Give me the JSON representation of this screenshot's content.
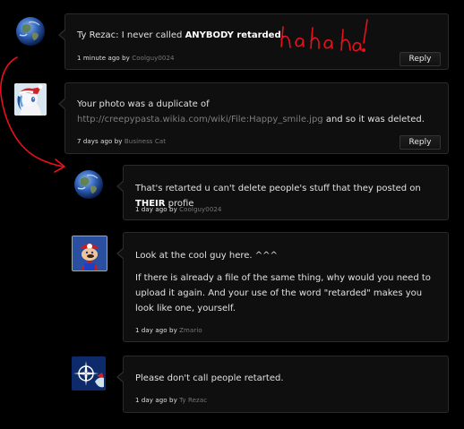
{
  "comments": [
    {
      "pre": "Ty Rezac: I never called ",
      "bold": "ANYBODY retarded.",
      "time": "1 minute ago by",
      "user": "Coolguy0024",
      "reply": "Reply",
      "avatar": "earth-avatar"
    },
    {
      "pre": "Your photo was a duplicate of ",
      "link": "http://creepypasta.wikia.com/wiki/File:Happy_smile.jpg",
      "post": " and so it was deleted.",
      "time": "7 days ago by",
      "user": "Business Cat",
      "reply": "Reply",
      "avatar": "pony-santa-avatar"
    },
    {
      "pre": "That's retarted u can't delete people's stuff that they posted on ",
      "bold": "THEIR",
      "post": " profie",
      "time": "1 day ago by",
      "user": "Coolguy0024",
      "avatar": "earth-avatar"
    },
    {
      "line1": "Look at the cool guy here. ^^^",
      "line2": "If there is already a file of the same thing, why would you need to upload it again. And your use of the word \"retarded\" makes you look like one, yourself.",
      "time": "1 day ago by",
      "user": "Zmario",
      "avatar": "mario-avatar"
    },
    {
      "line1": "Please don't call people retarted.",
      "time": "1 day ago by",
      "user": "Ty Rezac",
      "avatar": "nato-avatar"
    }
  ],
  "annotation": {
    "text": "hahaha!",
    "color": "#e8101a"
  }
}
